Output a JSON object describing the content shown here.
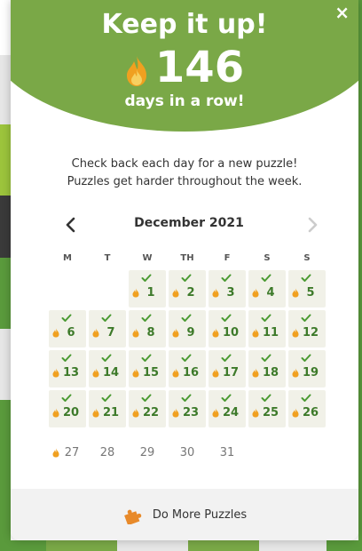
{
  "modal": {
    "close_label": "×",
    "title": "Keep it up!",
    "streak_count": "146",
    "streak_caption": "days in a row!",
    "info_line1": "Check back each day for a new puzzle!",
    "info_line2": "Puzzles get harder throughout the week."
  },
  "calendar": {
    "month_label": "December 2021",
    "weekdays": [
      "M",
      "T",
      "W",
      "TH",
      "F",
      "S",
      "S"
    ],
    "days": [
      {
        "day": "1",
        "state": "done"
      },
      {
        "day": "2",
        "state": "done"
      },
      {
        "day": "3",
        "state": "done"
      },
      {
        "day": "4",
        "state": "done"
      },
      {
        "day": "5",
        "state": "done"
      },
      {
        "day": "6",
        "state": "done"
      },
      {
        "day": "7",
        "state": "done"
      },
      {
        "day": "8",
        "state": "done"
      },
      {
        "day": "9",
        "state": "done"
      },
      {
        "day": "10",
        "state": "done"
      },
      {
        "day": "11",
        "state": "done"
      },
      {
        "day": "12",
        "state": "done"
      },
      {
        "day": "13",
        "state": "done"
      },
      {
        "day": "14",
        "state": "done"
      },
      {
        "day": "15",
        "state": "done"
      },
      {
        "day": "16",
        "state": "done"
      },
      {
        "day": "17",
        "state": "done"
      },
      {
        "day": "18",
        "state": "done"
      },
      {
        "day": "19",
        "state": "done"
      },
      {
        "day": "20",
        "state": "done"
      },
      {
        "day": "21",
        "state": "done"
      },
      {
        "day": "22",
        "state": "done"
      },
      {
        "day": "23",
        "state": "done"
      },
      {
        "day": "24",
        "state": "done"
      },
      {
        "day": "25",
        "state": "done"
      },
      {
        "day": "26",
        "state": "done"
      },
      {
        "day": "27",
        "state": "today"
      },
      {
        "day": "28",
        "state": "future"
      },
      {
        "day": "29",
        "state": "future"
      },
      {
        "day": "30",
        "state": "future"
      },
      {
        "day": "31",
        "state": "future"
      }
    ]
  },
  "footer": {
    "label": "Do More Puzzles"
  },
  "colors": {
    "header_green": "#7aa847",
    "day_green": "#3d7a2a",
    "flame_orange": "#f0a020",
    "done_cell": "#f1f1e8"
  }
}
